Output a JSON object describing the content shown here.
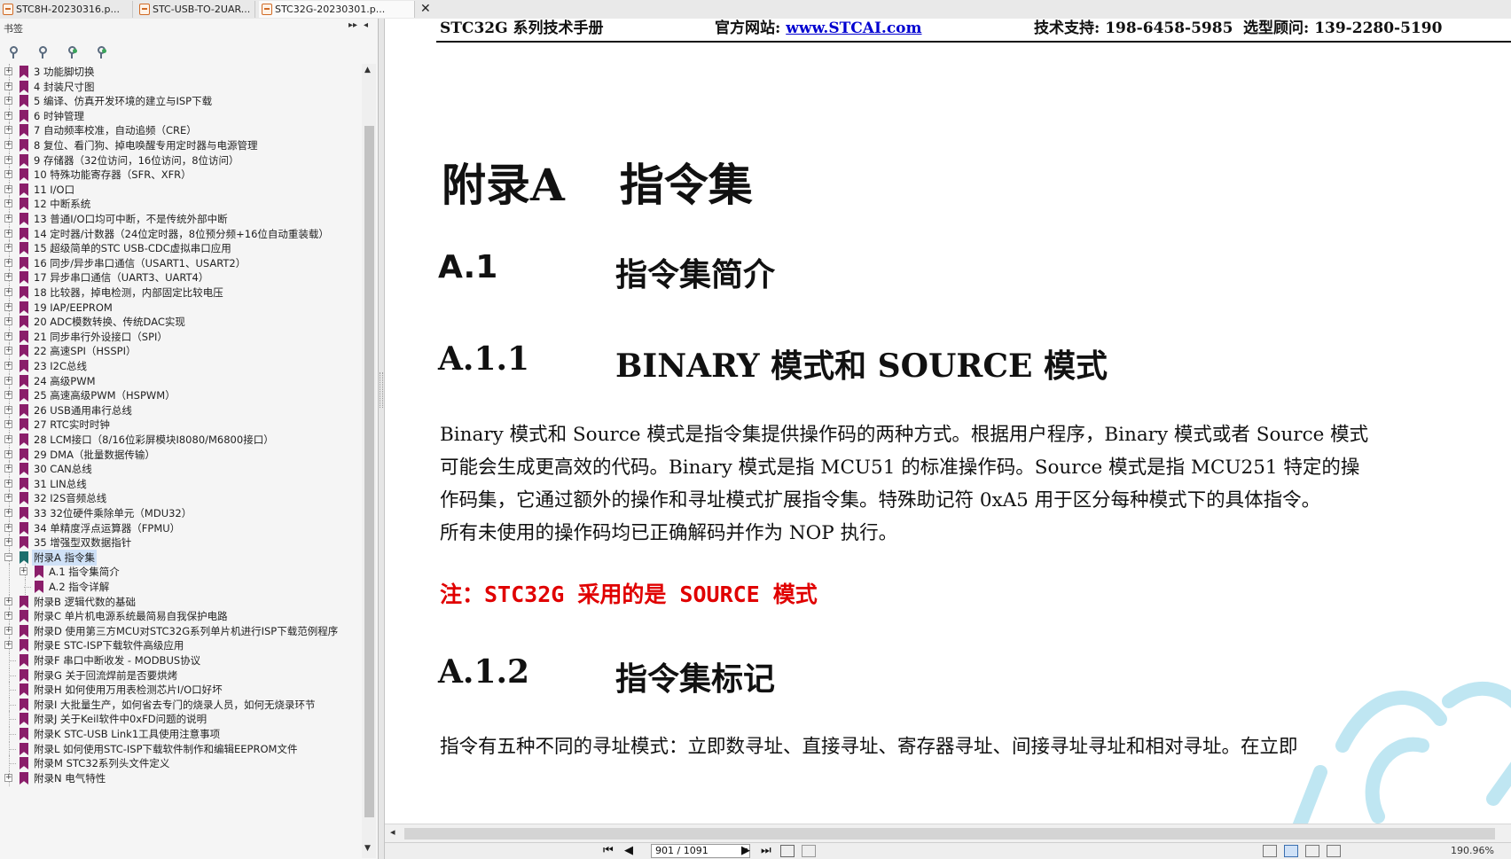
{
  "tabs": [
    {
      "label": "STC8H-20230316.p..."
    },
    {
      "label": "STC-USB-TO-2UAR..."
    },
    {
      "label": "STC32G-20230301.p..."
    }
  ],
  "sidebar": {
    "title": "书签",
    "expand_symbol": "▸▸",
    "collapse_symbol": "◂",
    "items": [
      {
        "label": "3 功能脚切换"
      },
      {
        "label": "4 封装尺寸图"
      },
      {
        "label": "5 编译、仿真开发环境的建立与ISP下载"
      },
      {
        "label": "6 时钟管理"
      },
      {
        "label": "7 自动频率校准，自动追频（CRE）"
      },
      {
        "label": "8 复位、看门狗、掉电唤醒专用定时器与电源管理"
      },
      {
        "label": "9 存储器（32位访问，16位访问，8位访问）"
      },
      {
        "label": "10 特殊功能寄存器（SFR、XFR）"
      },
      {
        "label": "11 I/O口"
      },
      {
        "label": "12 中断系统"
      },
      {
        "label": "13 普通I/O口均可中断，不是传统外部中断"
      },
      {
        "label": "14 定时器/计数器（24位定时器，8位预分频+16位自动重装载）"
      },
      {
        "label": "15 超级简单的STC USB-CDC虚拟串口应用"
      },
      {
        "label": "16 同步/异步串口通信（USART1、USART2）"
      },
      {
        "label": "17 异步串口通信（UART3、UART4）"
      },
      {
        "label": "18 比较器，掉电检测，内部固定比较电压"
      },
      {
        "label": "19 IAP/EEPROM"
      },
      {
        "label": "20 ADC模数转换、传统DAC实现"
      },
      {
        "label": "21 同步串行外设接口（SPI）"
      },
      {
        "label": "22 高速SPI（HSSPI）"
      },
      {
        "label": "23 I2C总线"
      },
      {
        "label": "24 高级PWM"
      },
      {
        "label": "25 高速高级PWM（HSPWM）"
      },
      {
        "label": "26 USB通用串行总线"
      },
      {
        "label": "27 RTC实时时钟"
      },
      {
        "label": "28 LCM接口（8/16位彩屏模块I8080/M6800接口）"
      },
      {
        "label": "29 DMA（批量数据传输）"
      },
      {
        "label": "30 CAN总线"
      },
      {
        "label": "31 LIN总线"
      },
      {
        "label": "32 I2S音频总线"
      },
      {
        "label": "33 32位硬件乘除单元（MDU32）"
      },
      {
        "label": "34 单精度浮点运算器（FPMU）"
      },
      {
        "label": "35 增强型双数据指针"
      },
      {
        "label": "附录A 指令集"
      },
      {
        "label": "A.1 指令集简介"
      },
      {
        "label": "A.2 指令详解"
      },
      {
        "label": "附录B 逻辑代数的基础"
      },
      {
        "label": "附录C 单片机电源系统最简易自我保护电路"
      },
      {
        "label": "附录D 使用第三方MCU对STC32G系列单片机进行ISP下载范例程序"
      },
      {
        "label": "附录E STC-ISP下载软件高级应用"
      },
      {
        "label": "附录F 串口中断收发 - MODBUS协议"
      },
      {
        "label": "附录G 关于回流焊前是否要烘烤"
      },
      {
        "label": "附录H 如何使用万用表检测芯片I/O口好坏"
      },
      {
        "label": "附录I 大批量生产，如何省去专门的烧录人员，如何无烧录环节"
      },
      {
        "label": "附录J 关于Keil软件中0xFD问题的说明"
      },
      {
        "label": "附录K STC-USB Link1工具使用注意事项"
      },
      {
        "label": "附录L 如何使用STC-ISP下载软件制作和编辑EEPROM文件"
      },
      {
        "label": "附录M STC32系列头文件定义"
      },
      {
        "label": "附录N 电气特性"
      }
    ]
  },
  "document": {
    "header": {
      "manual": "STC32G 系列技术手册",
      "site_label": "官方网站: ",
      "site_link": "www.STCAI.com",
      "support": "技术支持: 198-6458-5985",
      "advisor": "选型顾问: 139-2280-5190"
    },
    "appendix_num": "附录A",
    "appendix_title": "指令集",
    "s1_num": "A.1",
    "s1_title": "指令集简介",
    "s11_num": "A.1.1",
    "s11_title": "BINARY 模式和 SOURCE 模式",
    "para1": [
      "Binary 模式和 Source 模式是指令集提供操作码的两种方式。根据用户程序，Binary 模式或者 Source 模式",
      "可能会生成更高效的代码。Binary 模式是指 MCU51 的标准操作码。Source 模式是指 MCU251 特定的操",
      "作码集，它通过额外的操作和寻址模式扩展指令集。特殊助记符 0xA5 用于区分每种模式下的具体指令。",
      "所有未使用的操作码均已正确解码并作为 NOP 执行。"
    ],
    "note": "注：STC32G 采用的是 SOURCE 模式",
    "s12_num": "A.1.2",
    "s12_title": "指令集标记",
    "para2": "指令有五种不同的寻址模式：立即数寻址、直接寻址、寄存器寻址、间接寻址寻址和相对寻址。在立即",
    "watermark_color": "#bfe6f2"
  },
  "statusbar": {
    "page_display": "901 / 1091",
    "zoom": "190.96%"
  }
}
